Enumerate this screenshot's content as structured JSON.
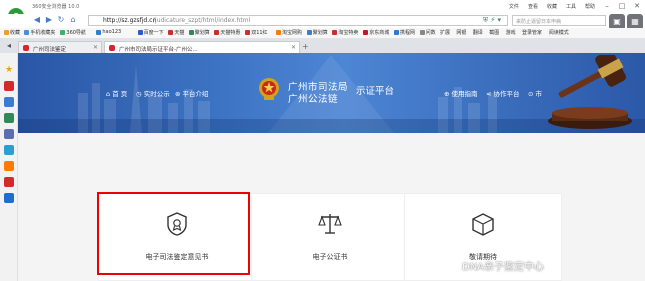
{
  "browser": {
    "title": "360安全浏览器 10.0",
    "menu": [
      "文件",
      "查看",
      "收藏",
      "工具",
      "帮助"
    ],
    "address": {
      "host": "http://sz.gzsfjd.cn",
      "path": "/judicature_szpt/html/index.html"
    },
    "search_placeholder": "来防止逼留日本申病",
    "favorites": [
      {
        "label": "收藏",
        "color": "#f0a020"
      },
      {
        "label": "手机收藏夹",
        "color": "#4a90d9"
      },
      {
        "label": "360导航",
        "color": "#3cb371"
      },
      {
        "label": "hao123",
        "color": "#2e7dd6"
      },
      {
        "label": "百度一下",
        "color": "#2a5bd7"
      },
      {
        "label": "天猫",
        "color": "#d12c2c"
      },
      {
        "label": "聚划算",
        "color": "#2e8b57"
      },
      {
        "label": "天猫特惠",
        "color": "#d12c2c"
      },
      {
        "label": "双11红",
        "color": "#d12c2c"
      },
      {
        "label": "淘宝网购",
        "color": "#ff7a00"
      },
      {
        "label": "聚划算",
        "color": "#3a7bd5"
      },
      {
        "label": "淘宝特卖",
        "color": "#d12c2c"
      },
      {
        "label": "京东商城",
        "color": "#c81623"
      },
      {
        "label": "携程网",
        "color": "#2a7ad6"
      },
      {
        "label": "问数",
        "color": "#888888"
      }
    ],
    "fav_right": [
      "扩展",
      "网银",
      "翻译",
      "截图",
      "游戏",
      "登录管家",
      "阅读模式"
    ],
    "tabs": [
      {
        "label": "广州司法鉴定",
        "active": false
      },
      {
        "label": "广州市司法局示证平台-广州公...",
        "active": true
      }
    ]
  },
  "banner": {
    "nav_left": [
      {
        "icon": "home-icon",
        "label": "首 页"
      },
      {
        "icon": "clock-icon",
        "label": "实时公示"
      },
      {
        "icon": "info-icon",
        "label": "平台介绍"
      }
    ],
    "site_name_line1": "广州市司法局",
    "site_name_line2": "广州公法链",
    "site_name_suffix": "示证平台",
    "nav_right": [
      {
        "icon": "guide-icon",
        "label": "使用指南"
      },
      {
        "icon": "share-icon",
        "label": "协作平台"
      },
      {
        "icon": "account-icon",
        "label": "市"
      }
    ]
  },
  "cards": [
    {
      "icon": "badge-icon",
      "label": "电子司法鉴定意见书",
      "highlighted": true
    },
    {
      "icon": "scale-icon",
      "label": "电子公证书",
      "highlighted": false
    },
    {
      "icon": "box-icon",
      "label": "敬请期待",
      "highlighted": false
    }
  ],
  "watermark": "DNA亲子鉴定中心",
  "colors": {
    "banner": "#3f76c6",
    "highlight": "#e00000",
    "tab_icon": "#d8242b"
  }
}
